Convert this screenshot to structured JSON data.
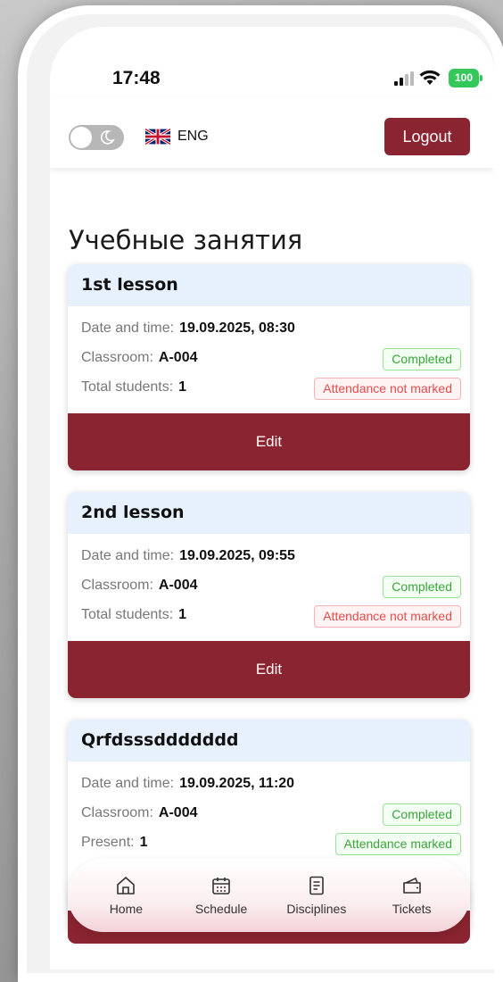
{
  "status": {
    "time": "17:48",
    "battery": "100"
  },
  "header": {
    "language": "ENG",
    "logout_label": "Logout"
  },
  "page": {
    "title": "Учебные занятия"
  },
  "lessons": [
    {
      "title": "1st lesson",
      "datetime_label": "Date and time:",
      "datetime": "19.09.2025, 08:30",
      "classroom_label": "Classroom:",
      "classroom": "A-004",
      "count_label": "Total students:",
      "count": "1",
      "status_badge": "Completed",
      "attendance_badge": "Attendance not marked",
      "edit_label": "Edit"
    },
    {
      "title": "2nd lesson",
      "datetime_label": "Date and time:",
      "datetime": "19.09.2025, 09:55",
      "classroom_label": "Classroom:",
      "classroom": "A-004",
      "count_label": "Total students:",
      "count": "1",
      "status_badge": "Completed",
      "attendance_badge": "Attendance not marked",
      "edit_label": "Edit"
    },
    {
      "title": "Qrfdsssddddddd",
      "datetime_label": "Date and time:",
      "datetime": "19.09.2025, 11:20",
      "classroom_label": "Classroom:",
      "classroom": "A-004",
      "count_label": "Present:",
      "count": "1",
      "status_badge": "Completed",
      "attendance_badge": "Attendance marked"
    }
  ],
  "nav": {
    "items": [
      {
        "label": "Home",
        "icon": "home-icon"
      },
      {
        "label": "Schedule",
        "icon": "calendar-icon"
      },
      {
        "label": "Disciplines",
        "icon": "book-icon"
      },
      {
        "label": "Tickets",
        "icon": "ticket-icon"
      }
    ]
  },
  "colors": {
    "accent": "#8a2430",
    "card_header": "#e6f1fd",
    "success": "#3aa43a",
    "danger": "#e24c4c"
  }
}
